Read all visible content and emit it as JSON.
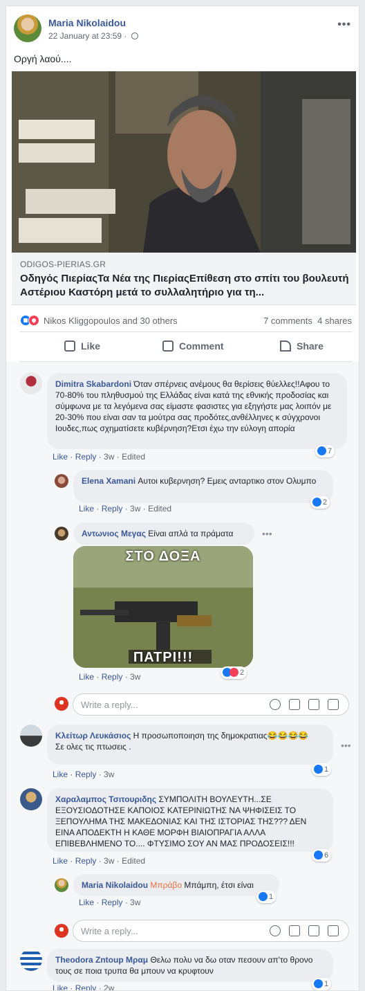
{
  "post": {
    "author": "Maria Nikolaidou",
    "timestamp": "22 January at 23:59",
    "text": "Οργή λαού....",
    "link": {
      "domain": "ODIGOS-PIERIAS.GR",
      "title": "Οδηγός ΠιερίαςΤα Νέα της ΠιερίαςΕπίθεση στο σπίτι του βουλευτή Αστέριου Καστόρη μετά το συλλαλητήριο για τη..."
    },
    "reactions_summary": "Nikos Kliggopoulos and 30 others",
    "comments_count": "7 comments",
    "shares_count": "4 shares",
    "actions": {
      "like": "Like",
      "comment": "Comment",
      "share": "Share"
    }
  },
  "ui": {
    "like": "Like",
    "reply": "Reply",
    "reply_placeholder": "Write a reply...",
    "edited": "Edited"
  },
  "comments": [
    {
      "author": "Dimitra Skabardoni",
      "text": "Όταν σπέρνεις ανέμους θα θερίσεις θύελλες!!Αφου το 70-80% του πληθυσμού της Ελλάδας είναι κατά της εθνικής προδοσίας και σύμφωνα με τα λεγόμενα σας είμαστε φασιστες για εξηγήστε μας λοιπόν με 20-30% που είναι σαν τα μούτρα σας προδότες,ανθέλληνες κ σύγχρονοι Ιουδες,πως σχηματίσετε κυβέρνηση?Ετσι έχω την εύλογη απορία",
      "time": "3w",
      "reactions": "7"
    },
    {
      "author": "Elena Xamani",
      "text": "Αυτοι κυβερνηση? Εμεις ανταρτικο στον Ολυμπο",
      "time": "3w",
      "reactions": "2"
    },
    {
      "author": "Αντωνιος Μεγας",
      "text": "Είναι απλά τα πράματα",
      "image_top_text": "ΣΤΟ ΔΟΞΑ",
      "image_bottom_text": "ΠΑΤΡΙ!!!",
      "time": "3w",
      "reactions": "2"
    },
    {
      "author": "Κλείτωρ Λευκάσιος",
      "text": "Η προσωποποιηση της δημοκρατιας😂😂😂😂",
      "text2": "Σε ολες τις πτωσεις .",
      "time": "3w",
      "reactions": "1"
    },
    {
      "author": "Χαραλαμπος Τσιτουριδης",
      "text": "ΣΥΜΠΟΛΙΤΗ ΒΟΥΛΕΥΤΗ...ΣΕ ΕΞΟΥΣΙΟΔΟΤΗΣΕ ΚΑΠΟΙΟΣ ΚΑΤΕΡΙΝΙΩΤΗΣ ΝΑ ΨΗΦΙΣΕΙΣ ΤΟ ΞΕΠΟΥΛΗΜΑ ΤΗΣ ΜΑΚΕΔΟΝΙΑΣ ΚΑΙ ΤΗΣ ΙΣΤΟΡΙΑΣ ΤΗΣ??? ΔΕΝ ΕΙΝΑ ΑΠΟΔΕΚΤΗ Η ΚΑΘΕ ΜΟΡΦΗ ΒΙΑΙΟΠΡΑΓΙΑ ΑΛΛΑ ΕΠΙΒΕΒΛΗΜΕΝΟ ΤΟ.... ΦΤΥΣΙΜΟ ΣΟΥ ΑΝ ΜΑΣ ΠΡΟΔΟΣΕΙΣ!!!",
      "time": "3w",
      "reactions": "6"
    },
    {
      "author": "Maria Nikolaidou",
      "mention": "Μπράβο",
      "text": "Μπάμπη, έτσι είναι",
      "time": "3w",
      "reactions": "1"
    },
    {
      "author": "Theodora Zntoup Μραμ",
      "text": "Θελω πολυ να δω οταν πεσουν απ'το θρονο τους σε ποια τρυπα θα μπουν να κρυφτουν",
      "time": "2w",
      "reactions": "1"
    }
  ],
  "colors": {
    "link": "#385898",
    "like_blue": "#1877f2",
    "love_red": "#f33e58",
    "mention": "#e9703e"
  }
}
